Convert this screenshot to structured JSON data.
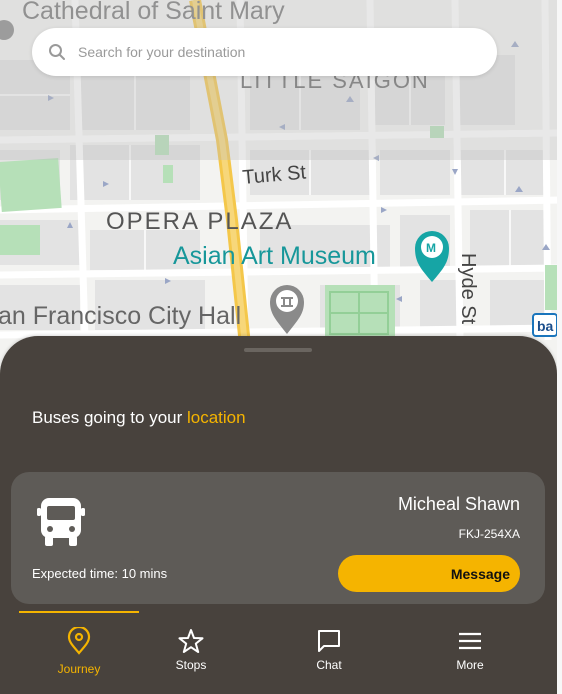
{
  "map": {
    "labels": {
      "cathedral": "Cathedral of Saint Mary",
      "little_saigon": "LITTLE SAIGON",
      "turk_st": "Turk St",
      "opera_plaza": "OPERA PLAZA",
      "asian_art_museum": "Asian Art Museum",
      "hyde_st": "Hyde St",
      "city_hall": "an Francisco City Hall",
      "transit_badge": "ba"
    },
    "colors": {
      "road_major": "#f4c74a",
      "park": "#b6e0b8",
      "poi_teal": "#15a3a3",
      "poi_grey": "#8a8a8a"
    }
  },
  "search": {
    "placeholder": "Search for your destination",
    "value": ""
  },
  "sheet": {
    "heading_prefix": "Buses going to your ",
    "heading_accent": "location",
    "accent_color": "#f5b400",
    "background_color": "#48423d"
  },
  "bus_card": {
    "driver_name": "Micheal Shawn",
    "plate": "FKJ-254XA",
    "eta": "Expected time: 10 mins",
    "message_label": "Message",
    "icon": "bus-icon"
  },
  "nav": {
    "items": [
      {
        "label": "Journey",
        "icon": "location-pin-icon",
        "active": true
      },
      {
        "label": "Stops",
        "icon": "star-icon",
        "active": false
      },
      {
        "label": "Chat",
        "icon": "chat-bubble-icon",
        "active": false
      },
      {
        "label": "More",
        "icon": "menu-icon",
        "active": false
      }
    ]
  }
}
